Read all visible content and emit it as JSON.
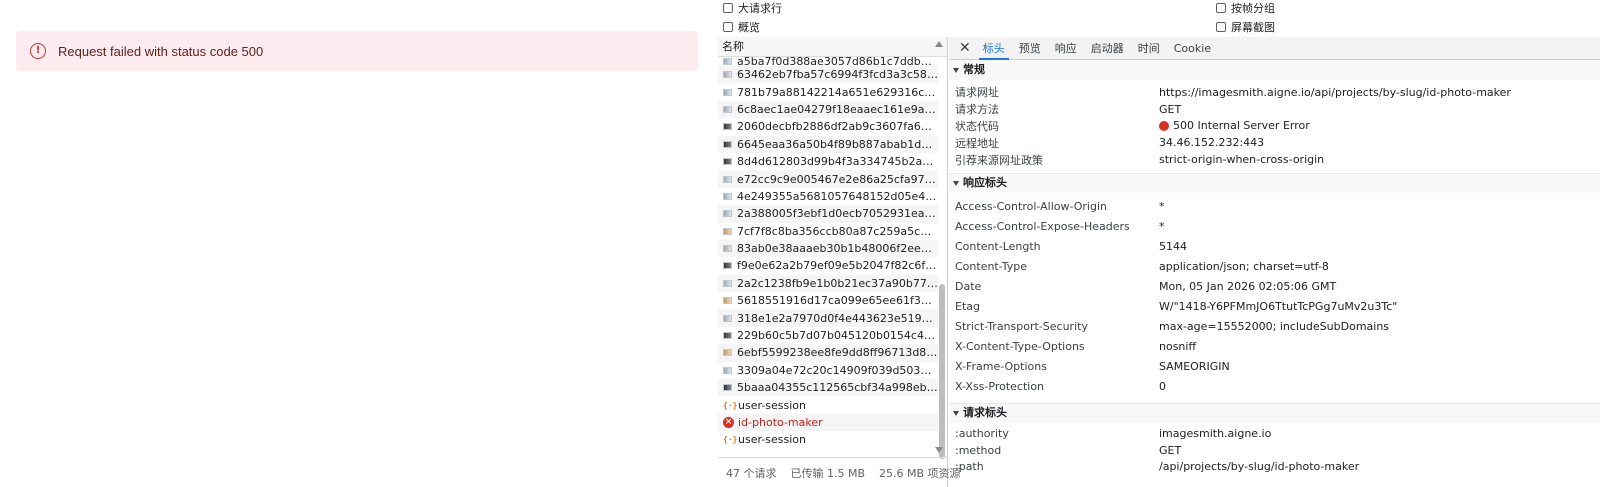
{
  "alert": {
    "message": "Request failed with status code 500"
  },
  "filters": {
    "big_rows": "大请求行",
    "overview": "概览",
    "group_by_frame": "按帧分组",
    "screenshots": "屏幕截图"
  },
  "requests": {
    "column_name": "名称",
    "items": [
      {
        "name": "a5ba7f0d388ae3057d86b1c7ddbd6f34...",
        "icon": "thumb"
      },
      {
        "name": "63462eb7fba57c6994f3fcd3a3c589f3.p...",
        "icon": "thumb"
      },
      {
        "name": "781b79a88142214a651e629316ccefc7....",
        "icon": "thumb"
      },
      {
        "name": "6c8aec1ae04279f18eaaec161e9aee12....",
        "icon": "thumb"
      },
      {
        "name": "2060decbfb2886df2ab9c3607fa6505d....",
        "icon": "thumb-dark"
      },
      {
        "name": "6645eaa36a50b4f89b887abab1d881fa....",
        "icon": "thumb-dark"
      },
      {
        "name": "8d4d612803d99b4f3a334745b2a5eef6....",
        "icon": "thumb-dark"
      },
      {
        "name": "e72cc9c9e005467e2e86a25cfa97c641....",
        "icon": "thumb"
      },
      {
        "name": "4e249355a5681057648152d05e4f0176....",
        "icon": "thumb"
      },
      {
        "name": "2a388005f3ebf1d0ecb7052931ea3d39....",
        "icon": "thumb"
      },
      {
        "name": "7cf7f8c8ba356ccb80a87c259a5c9866.p...",
        "icon": "thumb-warm"
      },
      {
        "name": "83ab0e38aaaeb30b1b48006f2ee86591....",
        "icon": "thumb"
      },
      {
        "name": "f9e0e62a2b79ef09e5b2047f82c6f259.p...",
        "icon": "thumb-dark"
      },
      {
        "name": "2a2c1238fb9e1b0b21ec37a90b77c2f1....",
        "icon": "thumb"
      },
      {
        "name": "5618551916d17ca099e65ee61f34789b...",
        "icon": "thumb-warm"
      },
      {
        "name": "318e1e2a7970d0f4e443623e519e10cf....",
        "icon": "thumb"
      },
      {
        "name": "229b60c5b7d07b045120b0154c4e4b5....",
        "icon": "thumb-dark"
      },
      {
        "name": "6ebf5599238ee8fe9dd8ff96713d8996....",
        "icon": "thumb-warm"
      },
      {
        "name": "3309a04e72c20c14909f039d503d17b0....",
        "icon": "thumb"
      },
      {
        "name": "5baaa04355c112565cbf34a998eb76ce....",
        "icon": "thumb-dark"
      },
      {
        "name": "user-session",
        "icon": "fetch"
      },
      {
        "name": "id-photo-maker",
        "icon": "error"
      },
      {
        "name": "user-session",
        "icon": "fetch"
      }
    ]
  },
  "statusbar": {
    "count": "47 个请求",
    "transferred": "已传输 1.5 MB",
    "resources": "25.6 MB 项资源"
  },
  "tabs": {
    "headers": "标头",
    "preview": "预览",
    "response": "响应",
    "initiator": "启动器",
    "timing": "时间",
    "cookie": "Cookie"
  },
  "general": {
    "title": "常规",
    "rows": [
      {
        "k": "请求网址",
        "v": "https://imagesmith.aigne.io/api/projects/by-slug/id-photo-maker"
      },
      {
        "k": "请求方法",
        "v": "GET"
      },
      {
        "k": "状态代码",
        "v": "500 Internal Server Error"
      },
      {
        "k": "远程地址",
        "v": "34.46.152.232:443"
      },
      {
        "k": "引荐来源网址政策",
        "v": "strict-origin-when-cross-origin"
      }
    ]
  },
  "response_headers": {
    "title": "响应标头",
    "rows": [
      {
        "k": "Access-Control-Allow-Origin",
        "v": "*"
      },
      {
        "k": "Access-Control-Expose-Headers",
        "v": "*"
      },
      {
        "k": "Content-Length",
        "v": "5144"
      },
      {
        "k": "Content-Type",
        "v": "application/json; charset=utf-8"
      },
      {
        "k": "Date",
        "v": "Mon, 05 Jan 2026 02:05:06 GMT"
      },
      {
        "k": "Etag",
        "v": "W/\"1418-Y6PFMmJO6TtutTcPGg7uMv2u3Tc\""
      },
      {
        "k": "Strict-Transport-Security",
        "v": "max-age=15552000; includeSubDomains"
      },
      {
        "k": "X-Content-Type-Options",
        "v": "nosniff"
      },
      {
        "k": "X-Frame-Options",
        "v": "SAMEORIGIN"
      },
      {
        "k": "X-Xss-Protection",
        "v": "0"
      }
    ]
  },
  "request_headers": {
    "title": "请求标头",
    "rows": [
      {
        "k": ":authority",
        "v": "imagesmith.aigne.io"
      },
      {
        "k": ":method",
        "v": "GET"
      },
      {
        "k": ":path",
        "v": "/api/projects/by-slug/id-photo-maker"
      }
    ]
  }
}
